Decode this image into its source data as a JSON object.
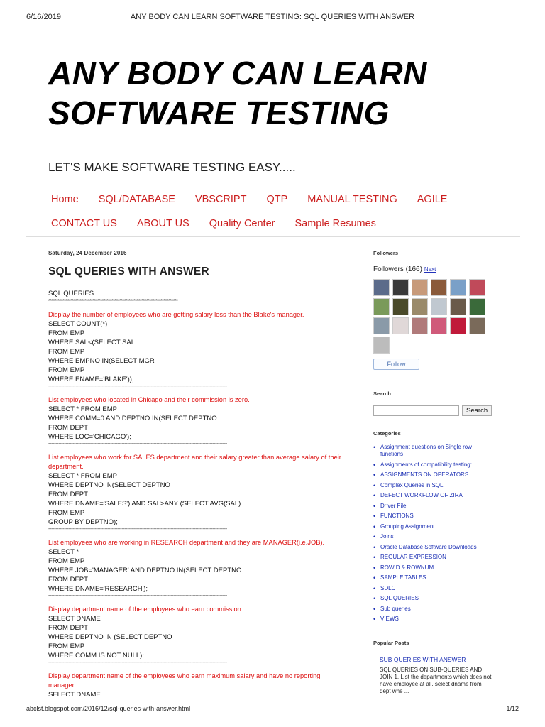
{
  "print_header": {
    "date": "6/16/2019",
    "title": "ANY BODY CAN LEARN SOFTWARE TESTING: SQL QUERIES WITH ANSWER"
  },
  "blog": {
    "title": "ANY BODY CAN LEARN SOFTWARE TESTING",
    "description": "LET'S MAKE SOFTWARE TESTING EASY....."
  },
  "nav": {
    "row1": [
      "Home",
      "SQL/DATABASE",
      "VBSCRIPT",
      "QTP",
      "MANUAL TESTING",
      "AGILE"
    ],
    "row2": [
      "CONTACT US",
      "ABOUT US",
      "Quality Center",
      "Sample Resumes"
    ]
  },
  "post": {
    "date": "Saturday, 24 December 2016",
    "title": "SQL QUERIES WITH ANSWER",
    "heading": "SQL QUERIES",
    "stars": "**********************************************************************************",
    "separator": "----------------------------------------------------------------------------------------------------------------------------",
    "blocks": [
      {
        "question": "Display the number of employees who are getting salary less than the Blake's manager.",
        "lines": [
          "SELECT COUNT(*)",
          "FROM EMP",
          "WHERE SAL<(SELECT SAL",
          "FROM EMP",
          "WHERE EMPNO IN(SELECT MGR",
          "FROM EMP",
          "WHERE ENAME='BLAKE'));"
        ]
      },
      {
        "question": "List employees who located in Chicago and their commission is zero.",
        "lines": [
          "SELECT * FROM EMP",
          "WHERE COMM=0 AND DEPTNO IN(SELECT DEPTNO",
          "FROM DEPT",
          "WHERE LOC='CHICAGO');"
        ]
      },
      {
        "question": "List employees who work for SALES department and their salary greater than average salary of their department.",
        "lines": [
          "SELECT * FROM EMP",
          "WHERE DEPTNO IN(SELECT DEPTNO",
          "FROM DEPT",
          "WHERE DNAME='SALES') AND SAL>ANY (SELECT AVG(SAL)",
          "FROM EMP",
          "GROUP BY DEPTNO);"
        ]
      },
      {
        "question": "List employees who are working in RESEARCH department and they are MANAGER(i.e.JOB).",
        "lines": [
          "SELECT *",
          "FROM EMP",
          "WHERE JOB='MANAGER' AND DEPTNO IN(SELECT DEPTNO",
          "FROM DEPT",
          "WHERE DNAME='RESEARCH');"
        ]
      },
      {
        "question": "Display department name of the employees who earn commission.",
        "lines": [
          "SELECT DNAME",
          "FROM DEPT",
          "WHERE DEPTNO IN (SELECT DEPTNO",
          "FROM EMP",
          "WHERE COMM IS NOT NULL);"
        ]
      },
      {
        "question": "Display department name of the employees who earn maximum salary and have no reporting manager.",
        "lines": [
          "SELECT DNAME"
        ]
      }
    ]
  },
  "sidebar": {
    "followers_title": "Followers",
    "followers_count": "Followers (166)",
    "next_label": "Next",
    "avatar_colors": [
      "#5b6b8a",
      "#3a3a3a",
      "#c79a7a",
      "#8a5a3a",
      "#7aa0c8",
      "#c04a5a",
      "#7a9a5a",
      "#4a4a2a",
      "#9a8a6a",
      "#c0c8d0",
      "#6a5a4a",
      "#3a6a3a",
      "#8a9aa8",
      "#e0d8d8",
      "#b07a7a",
      "#d05a7a",
      "#c01a3a",
      "#7a6a5a",
      "#bcbcbc"
    ],
    "follow_label": "Follow",
    "search_title": "Search",
    "search_button": "Search",
    "categories_title": "Categories",
    "categories": [
      "Assignment questions on Single row functions",
      "Assignments of compatibility testing:",
      "ASSIGNMENTS ON OPERATORS",
      "Complex Queries in SQL",
      "DEFECT WORKFLOW OF ZIRA",
      "Driver File",
      "FUNCTIONS",
      "Grouping Assignment",
      "Joins",
      "Oracle Database Software Downloads",
      "REGULAR EXPRESSION",
      "ROWID & ROWNUM",
      "SAMPLE TABLES",
      "SDLC",
      "SQL QUERIES",
      "Sub queries",
      "VIEWS"
    ],
    "popular_title": "Popular Posts",
    "popular_post_title": "SUB QUERIES WITH ANSWER",
    "popular_post_snippet": "SQL QUERIES ON SUB-QUERIES AND JOIN 1. List the departments which does not have employee at all. select dname from dept whe ..."
  },
  "print_footer": {
    "url": "abclst.blogspot.com/2016/12/sql-queries-with-answer.html",
    "page": "1/12"
  }
}
